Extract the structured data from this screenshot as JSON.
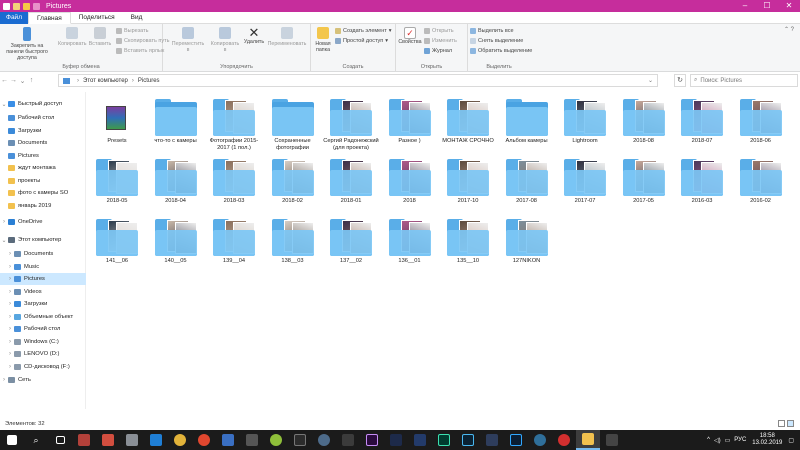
{
  "window": {
    "title": "Pictures"
  },
  "ribbon_tabs": [
    "Файл",
    "Главная",
    "Поделиться",
    "Вид"
  ],
  "ribbon": {
    "clipboard": {
      "pin": "Закрепить на панели быстрого доступа",
      "copy": "Копировать",
      "paste": "Вставить",
      "cut": "Вырезать",
      "copy_path": "Скопировать путь",
      "paste_shortcut": "Вставить ярлык",
      "label": "Буфер обмена"
    },
    "organize": {
      "move_to": "Переместить в",
      "copy_to": "Копировать в",
      "delete": "Удалить",
      "rename": "Переименовать",
      "label": "Упорядочить"
    },
    "new": {
      "new_folder": "Новая папка",
      "new_item": "Создать элемент",
      "easy_access": "Простой доступ",
      "label": "Создать"
    },
    "open": {
      "properties": "Свойства",
      "open": "Открыть",
      "edit": "Изменить",
      "history": "Журнал",
      "label": "Открыть"
    },
    "select": {
      "select_all": "Выделить все",
      "select_none": "Снять выделение",
      "invert": "Обратить выделение",
      "label": "Выделить"
    }
  },
  "address": {
    "path": [
      "Этот компьютер",
      "Pictures"
    ],
    "search_placeholder": "Поиск: Pictures"
  },
  "nav": {
    "quick_access": "Быстрый доступ",
    "quick_items": [
      "Рабочий стол",
      "Загрузки",
      "Documents",
      "Pictures",
      "ждут монтажа",
      "проекты",
      "фото с камеры SO",
      "январь 2019"
    ],
    "onedrive": "OneDrive",
    "this_pc": "Этот компьютер",
    "pc_items": [
      "Documents",
      "Music",
      "Pictures",
      "Videos",
      "Загрузки",
      "Объемные объект",
      "Рабочий стол",
      "Windows (C:)",
      "LENOVO (D:)",
      "CD-дисковод (F:)"
    ],
    "network": "Сеть"
  },
  "files": [
    "Presets",
    "что-то с камеры",
    "Фотографии 2015-2017 (1 пол.)",
    "Сохраненные фотографии",
    "Сергий Радонежский (для проекта)",
    "Разное )",
    "МОНТАЖ СРОЧНО",
    "Альбом камеры",
    "Lightroom",
    "2018-08",
    "2018-07",
    "2018-06",
    "2018-05",
    "2018-04",
    "2018-03",
    "2018-02",
    "2018-01",
    "2018",
    "2017-10",
    "2017-08",
    "2017-07",
    "2017-05",
    "2016-03",
    "2016-02",
    "141__06",
    "140__05",
    "139__04",
    "138__03",
    "137__02",
    "136__01",
    "135__10",
    "127NIKON"
  ],
  "status": {
    "count": "Элементов: 32"
  },
  "tray": {
    "lang": "РУС",
    "time": "18:58",
    "date": "13.02.2019"
  },
  "colors": {
    "titlebar": "#c62d9c",
    "folder": "#5aaee8",
    "selection": "#cce8ff"
  }
}
